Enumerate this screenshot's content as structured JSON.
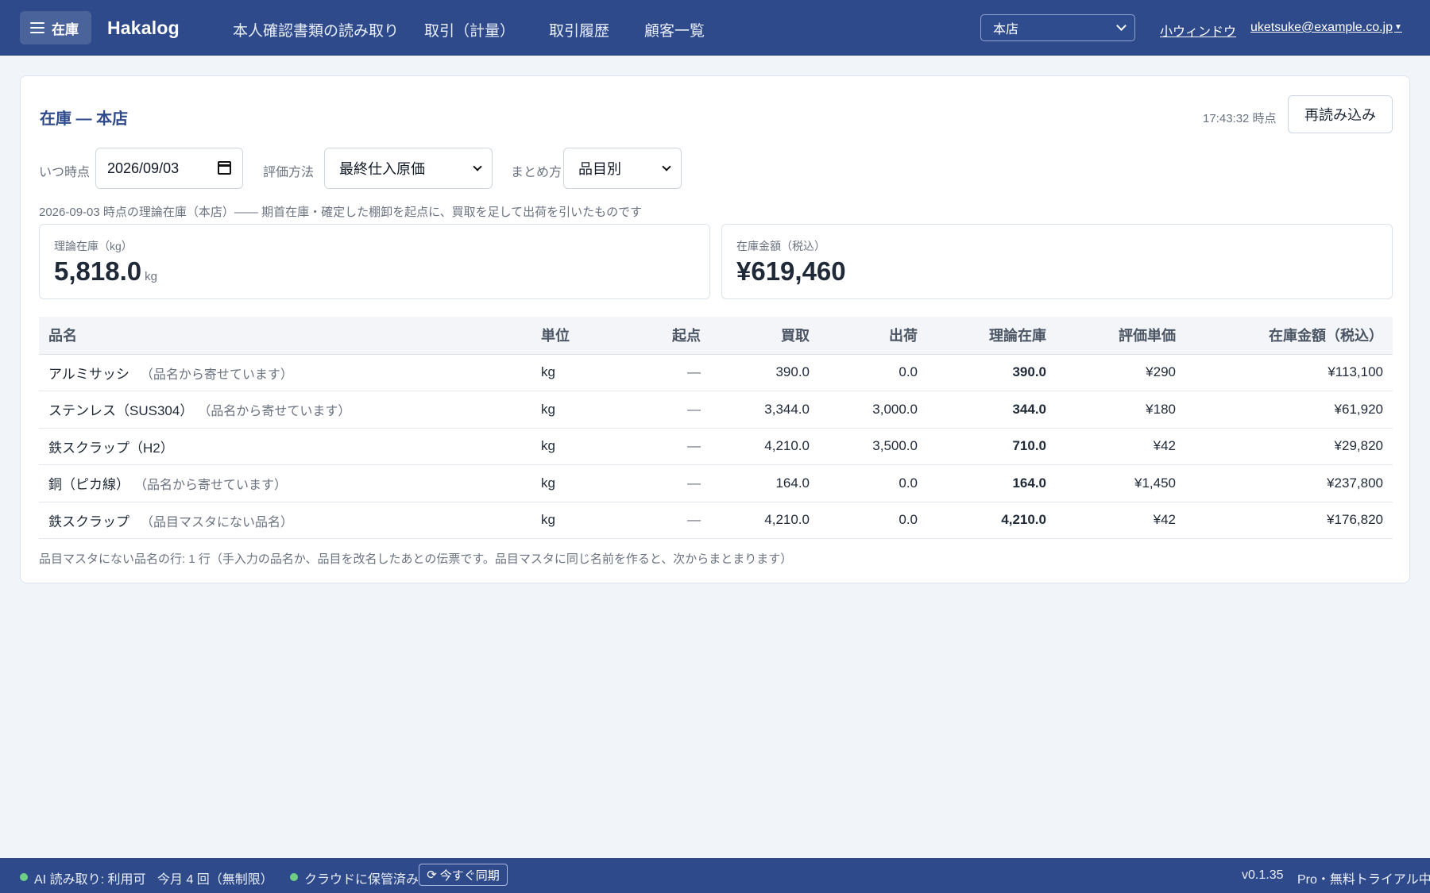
{
  "nav": {
    "menu_label": "在庫",
    "brand": "Hakalog",
    "links": [
      "本人確認書類の読み取り",
      "取引（計量）",
      "取引履歴",
      "顧客一覧"
    ],
    "store_selected": "本店",
    "small_window": "小ウィンドウ",
    "account": "uketsuke@example.co.jp"
  },
  "card": {
    "title": "在庫 — 本店",
    "timestamp": "17:43:32 時点",
    "reload_label": "再読み込み"
  },
  "filters": {
    "when_label": "いつ時点",
    "date_value": "2026/09/03",
    "method_label": "評価方法",
    "method_value": "最終仕入原価",
    "group_label": "まとめ方",
    "group_value": "品目別"
  },
  "description": "2026-09-03 時点の理論在庫（本店）—— 期首在庫・確定した棚卸を起点に、買取を足して出荷を引いたものです",
  "stats": {
    "stock_label": "理論在庫（kg）",
    "stock_value": "5,818.0",
    "stock_unit": "kg",
    "amount_label": "在庫金額（税込）",
    "amount_value": "¥619,460"
  },
  "table": {
    "headers": [
      "品名",
      "単位",
      "起点",
      "買取",
      "出荷",
      "理論在庫",
      "評価単価",
      "在庫金額（税込）"
    ],
    "rows": [
      {
        "name": "アルミサッシ",
        "note": "（品名から寄せています）",
        "unit": "kg",
        "origin": "—",
        "buy": "390.0",
        "ship": "0.0",
        "stock": "390.0",
        "price": "¥290",
        "amount": "¥113,100"
      },
      {
        "name": "ステンレス（SUS304）",
        "note": "（品名から寄せています）",
        "unit": "kg",
        "origin": "—",
        "buy": "3,344.0",
        "ship": "3,000.0",
        "stock": "344.0",
        "price": "¥180",
        "amount": "¥61,920"
      },
      {
        "name": "鉄スクラップ（H2）",
        "note": "",
        "unit": "kg",
        "origin": "—",
        "buy": "4,210.0",
        "ship": "3,500.0",
        "stock": "710.0",
        "price": "¥42",
        "amount": "¥29,820"
      },
      {
        "name": "銅（ピカ線）",
        "note": "（品名から寄せています）",
        "unit": "kg",
        "origin": "—",
        "buy": "164.0",
        "ship": "0.0",
        "stock": "164.0",
        "price": "¥1,450",
        "amount": "¥237,800"
      },
      {
        "name": "鉄スクラップ",
        "note": "（品目マスタにない品名）",
        "unit": "kg",
        "origin": "—",
        "buy": "4,210.0",
        "ship": "0.0",
        "stock": "4,210.0",
        "price": "¥42",
        "amount": "¥176,820"
      }
    ],
    "footnote": "品目マスタにない品名の行: 1 行（手入力の品名か、品目を改名したあとの伝票です。品目マスタに同じ名前を作ると、次からまとまります）"
  },
  "statusbar": {
    "ai_status": "AI 読み取り: 利用可",
    "monthly_count": "今月 4 回（無制限）",
    "cloud_status": "クラウドに保管済み",
    "sync_label": "今すぐ同期",
    "version": "v0.1.35",
    "plan": "Pro・無料トライアル中"
  },
  "colors": {
    "primary": "#2e4a8b",
    "status_ok": "#6fcf85",
    "background": "#f1f4f8"
  }
}
